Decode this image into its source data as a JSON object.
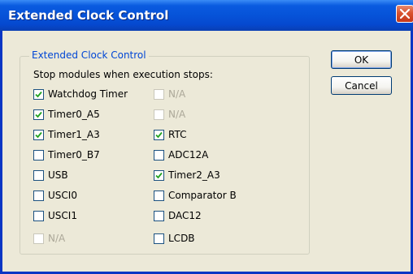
{
  "window": {
    "title": "Extended Clock Control",
    "close_icon": "close-icon"
  },
  "group": {
    "title": "Extended Clock Control",
    "instruction": "Stop modules when execution stops:"
  },
  "left_column": [
    {
      "label": "Watchdog Timer",
      "checked": true,
      "enabled": true
    },
    {
      "label": "Timer0_A5",
      "checked": true,
      "enabled": true
    },
    {
      "label": "Timer1_A3",
      "checked": true,
      "enabled": true
    },
    {
      "label": "Timer0_B7",
      "checked": false,
      "enabled": true
    },
    {
      "label": "USB",
      "checked": false,
      "enabled": true
    },
    {
      "label": "USCI0",
      "checked": false,
      "enabled": true
    },
    {
      "label": "USCI1",
      "checked": false,
      "enabled": true
    },
    {
      "label": "N/A",
      "checked": false,
      "enabled": false
    }
  ],
  "right_column": [
    {
      "label": "N/A",
      "checked": false,
      "enabled": false
    },
    {
      "label": "N/A",
      "checked": false,
      "enabled": false
    },
    {
      "label": "RTC",
      "checked": true,
      "enabled": true
    },
    {
      "label": "ADC12A",
      "checked": false,
      "enabled": true
    },
    {
      "label": "Timer2_A3",
      "checked": true,
      "enabled": true
    },
    {
      "label": "Comparator B",
      "checked": false,
      "enabled": true
    },
    {
      "label": "DAC12",
      "checked": false,
      "enabled": true
    },
    {
      "label": "LCDB",
      "checked": false,
      "enabled": true
    }
  ],
  "buttons": {
    "ok": "OK",
    "cancel": "Cancel"
  },
  "colors": {
    "titlebar": "#0653d8",
    "group_title": "#0046d5",
    "checkmark": "#21a121"
  }
}
